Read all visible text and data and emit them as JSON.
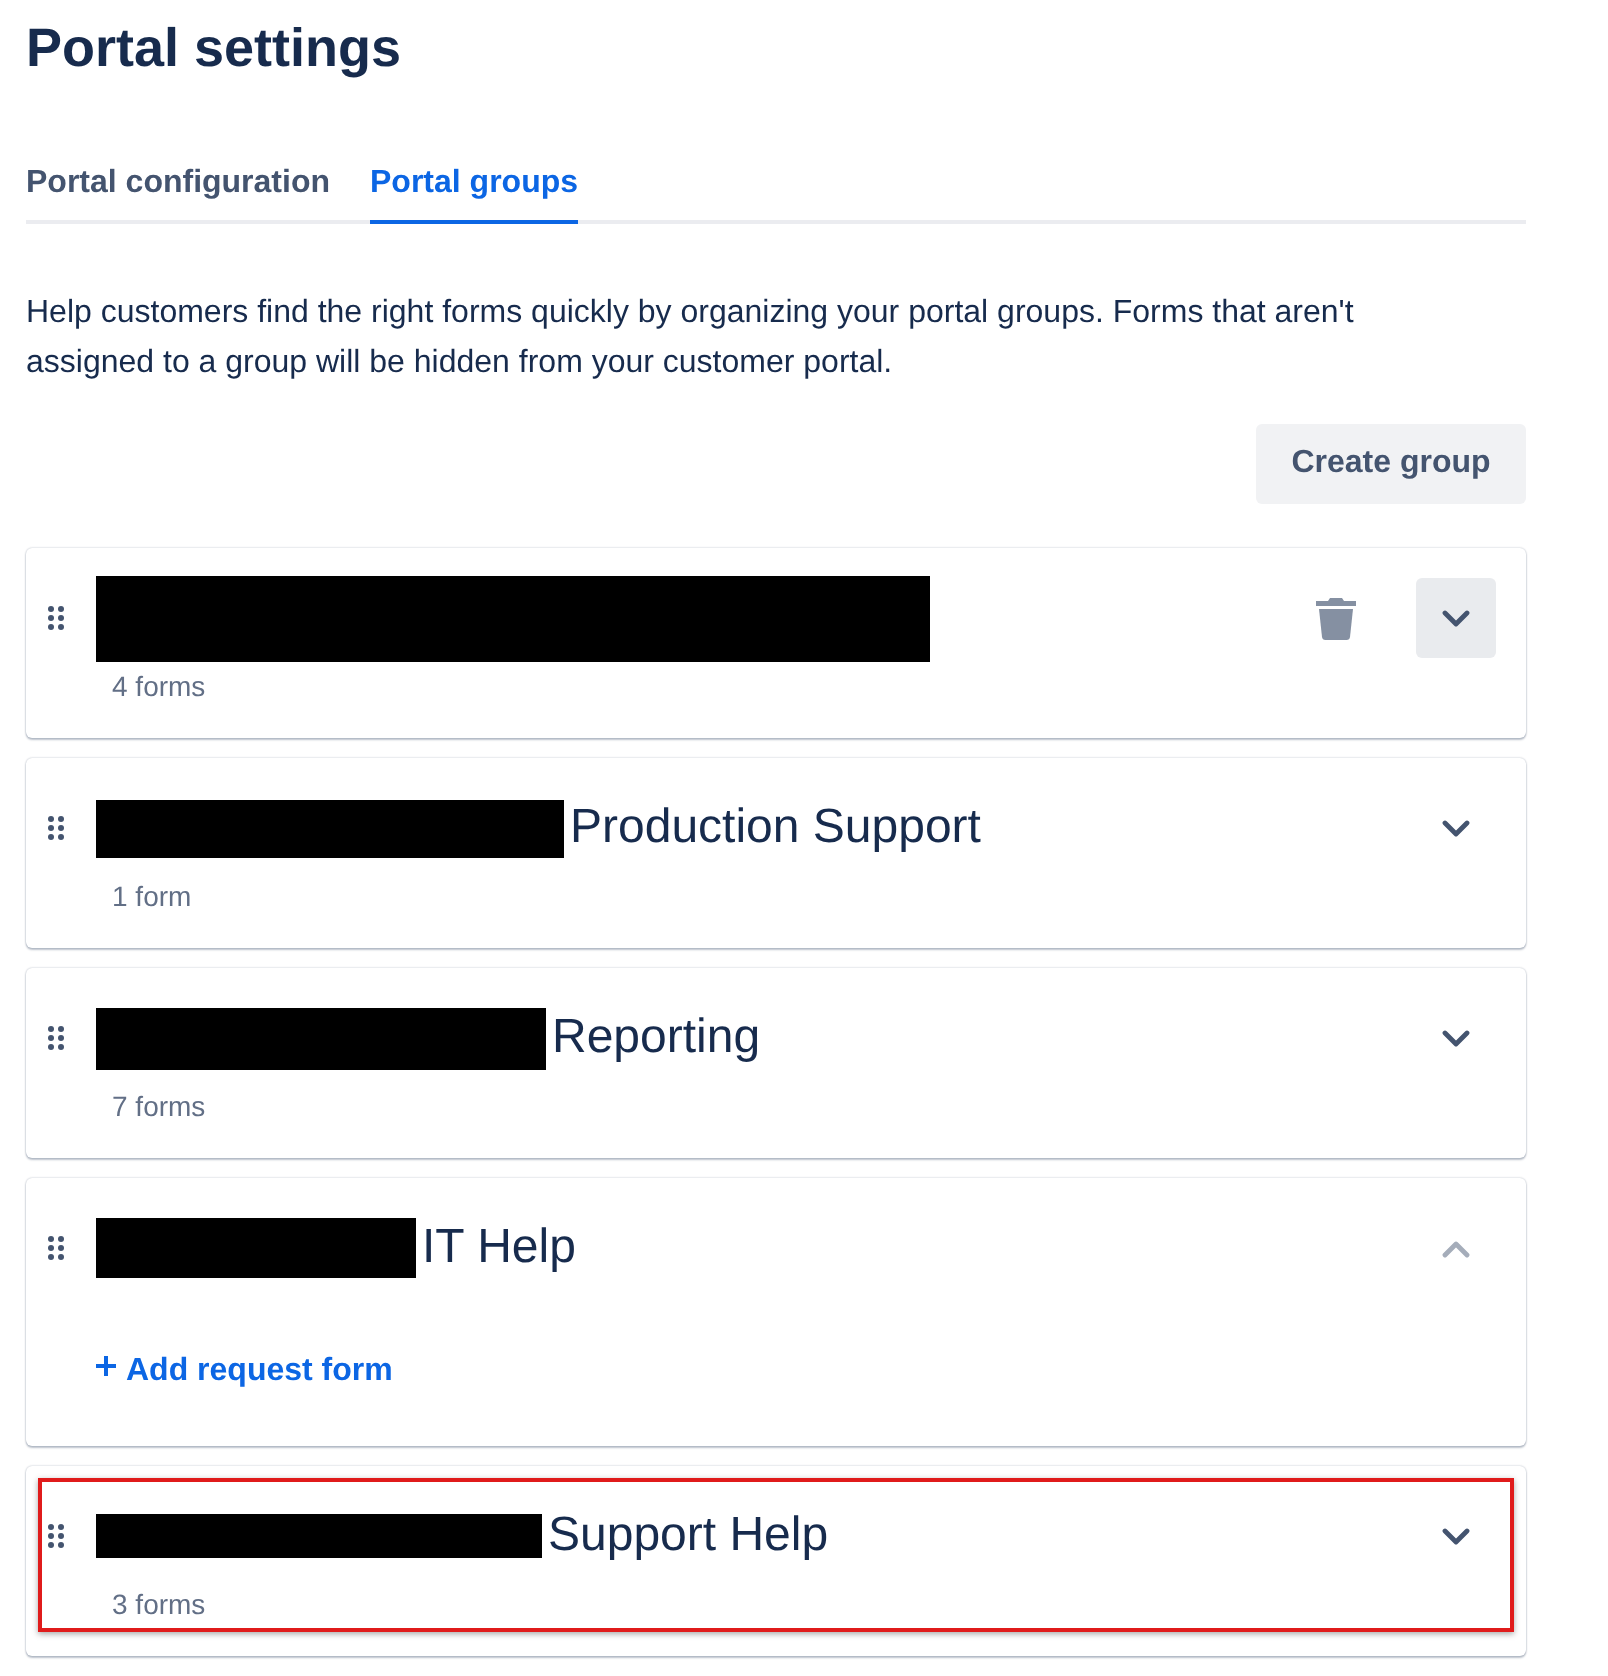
{
  "page": {
    "title": "Portal settings"
  },
  "tabs": [
    {
      "label": "Portal configuration",
      "selected": false
    },
    {
      "label": "Portal groups",
      "selected": true
    }
  ],
  "description": "Help customers find the right forms quickly by organizing your portal groups. Forms that aren't assigned to a group will be hidden from your customer portal.",
  "create_button": "Create group",
  "groups": [
    {
      "name_redacted": true,
      "count": "4 forms",
      "hovered": true,
      "expanded": false,
      "highlighted": false
    },
    {
      "name_redacted": true,
      "name": "Production Support",
      "count": "1 form",
      "hovered": false,
      "expanded": false,
      "highlighted": false
    },
    {
      "name_redacted": true,
      "name": "Reporting",
      "count": "7 forms",
      "hovered": false,
      "expanded": false,
      "highlighted": false
    },
    {
      "name_redacted": true,
      "name": "IT Help",
      "add_link": "Add request form",
      "hovered": false,
      "expanded": true,
      "highlighted": false
    },
    {
      "name_redacted": true,
      "name": "Support Help",
      "count": "3 forms",
      "hovered": false,
      "expanded": false,
      "highlighted": true
    }
  ]
}
